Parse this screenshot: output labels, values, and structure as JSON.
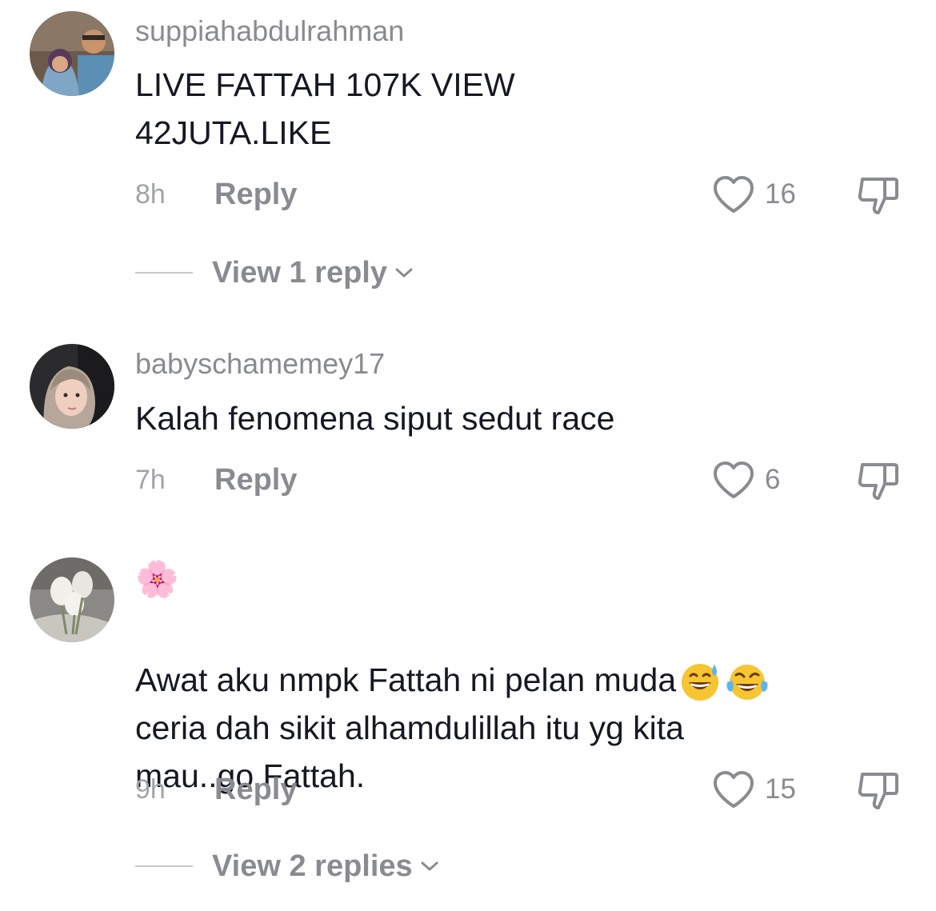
{
  "comments": [
    {
      "username": "suppiahabdulrahman",
      "text": "LIVE FATTAH 107K VIEW\n42JUTA.LIKE",
      "time": "8h",
      "reply_label": "Reply",
      "likes": "16",
      "view_replies": "View 1 reply"
    },
    {
      "username": "babyschamemey17",
      "text": "Kalah fenomena siput sedut race",
      "time": "7h",
      "reply_label": "Reply",
      "likes": "6"
    },
    {
      "username": "🌸",
      "text_line1": "Awat aku nmpk Fattah ni pelan muda",
      "text_rest": "ceria dah sikit alhamdulillah itu yg kita\nmau..go Fattah.",
      "time": "9h",
      "reply_label": "Reply",
      "likes": "15",
      "view_replies": "View 2 replies"
    }
  ],
  "icons": {
    "like": "heart-outline-icon",
    "dislike": "thumbs-down-icon",
    "chevron": "chevron-down-icon",
    "emoji1": "grinning-sweat-emoji",
    "emoji2": "tears-of-joy-emoji"
  },
  "colors": {
    "background": "#ffffff",
    "primary_text": "#161823",
    "secondary_text": "#8a8b91",
    "icon": "#8a8b91"
  }
}
